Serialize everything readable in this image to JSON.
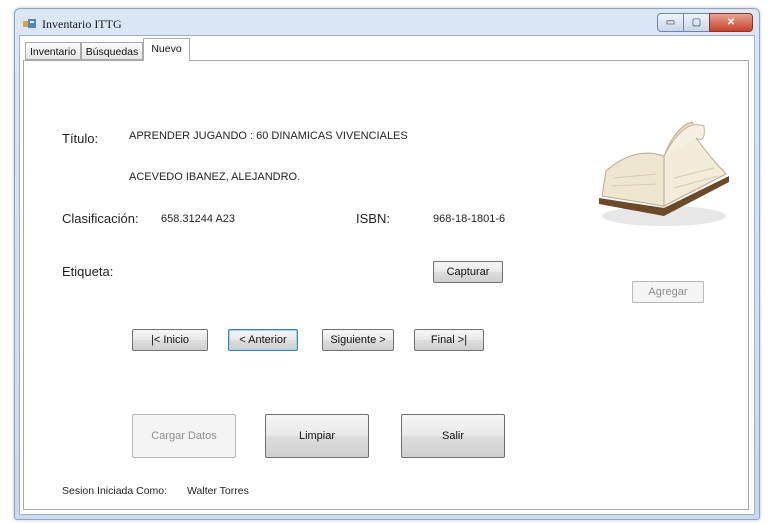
{
  "window": {
    "title": "Inventario ITTG",
    "minimize_glyph": "▭",
    "maximize_glyph": "▢",
    "close_glyph": "✕"
  },
  "tabs": [
    {
      "label": "Inventario",
      "active": false
    },
    {
      "label": "Búsquedas",
      "active": false
    },
    {
      "label": "Nuevo",
      "active": true
    }
  ],
  "form": {
    "titulo_label": "Título:",
    "titulo_value": "APRENDER JUGANDO : 60 DINAMICAS VIVENCIALES",
    "autor_value": "ACEVEDO IBANEZ, ALEJANDRO.",
    "clasificacion_label": "Clasificación:",
    "clasificacion_value": "658.31244 A23",
    "isbn_label": "ISBN:",
    "isbn_value": "968-18-1801-6",
    "etiqueta_label": "Etiqueta:"
  },
  "buttons": {
    "capturar": "Capturar",
    "agregar": "Agregar",
    "inicio": "|< Inicio",
    "anterior": "< Anterior",
    "siguiente": "Siguiente >",
    "final": "Final >|",
    "cargar_datos": "Cargar Datos",
    "limpiar": "Limpiar",
    "salir": "Salir"
  },
  "session": {
    "label": "Sesion Iniciada Como:",
    "user": "Walter Torres"
  },
  "icons": {
    "app": "app-icon",
    "book": "open-book-icon"
  }
}
